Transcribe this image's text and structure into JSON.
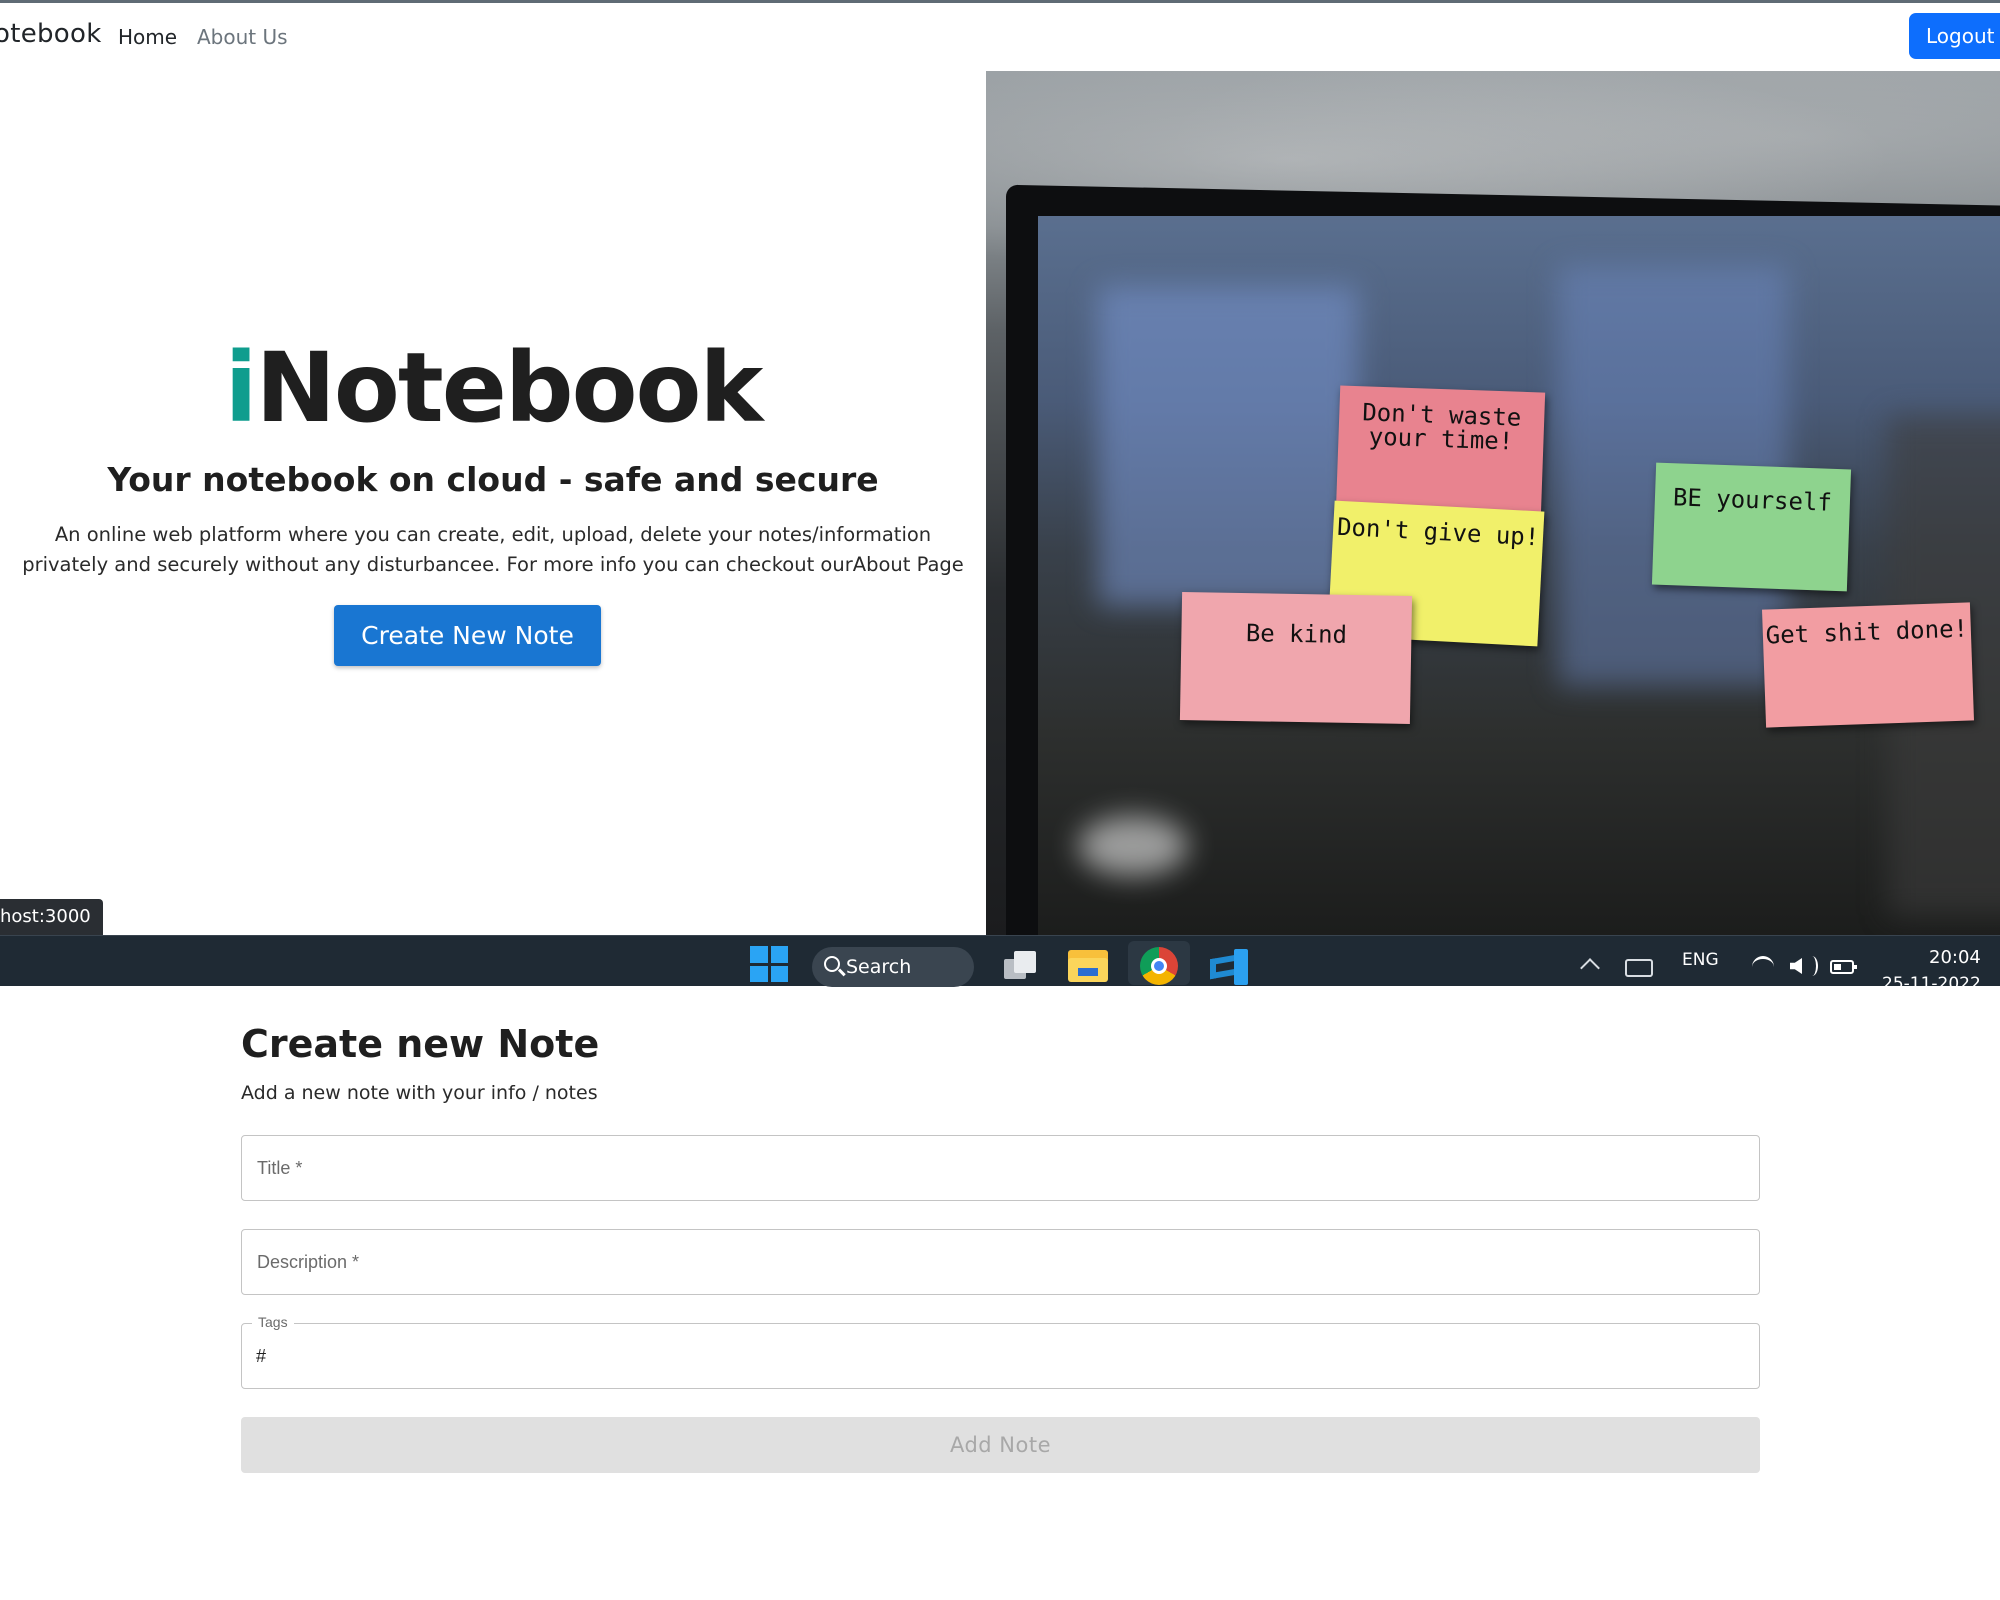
{
  "navbar": {
    "brand": "otebook",
    "links": [
      {
        "label": "Home"
      },
      {
        "label": "About Us"
      }
    ],
    "logout_label": "Logout"
  },
  "hero": {
    "title_first": "i",
    "title_rest": "Notebook",
    "subtitle": "Your notebook on cloud - safe and secure",
    "description": "An online web platform where you can create, edit, upload, delete your notes/information privately and securely without any disturbancee. For more info you can checkout ourAbout Page",
    "cta_label": "Create New Note",
    "image_notes": [
      "Don't waste your time!",
      "Don't give up!",
      "Be kind",
      "BE yourself",
      "Get shit done!"
    ]
  },
  "status_tooltip": "host:3000",
  "taskbar": {
    "search_label": "Search",
    "language": "ENG",
    "time": "20:04",
    "date": "25-11-2022",
    "apps": [
      "windows-start",
      "task-view",
      "file-explorer",
      "chrome",
      "vscode"
    ]
  },
  "form": {
    "title": "Create new Note",
    "subtitle": "Add a new note with your info / notes",
    "title_placeholder": "Title *",
    "description_placeholder": "Description *",
    "tags_label": "Tags",
    "tags_value": "#",
    "submit_label": "Add Note"
  },
  "colors": {
    "accent": "#0f9d8e",
    "primary_button": "#1976d2",
    "logout_button": "#0d6efd",
    "taskbar": "#1f2a34",
    "disabled_button": "#e0e0e0"
  }
}
